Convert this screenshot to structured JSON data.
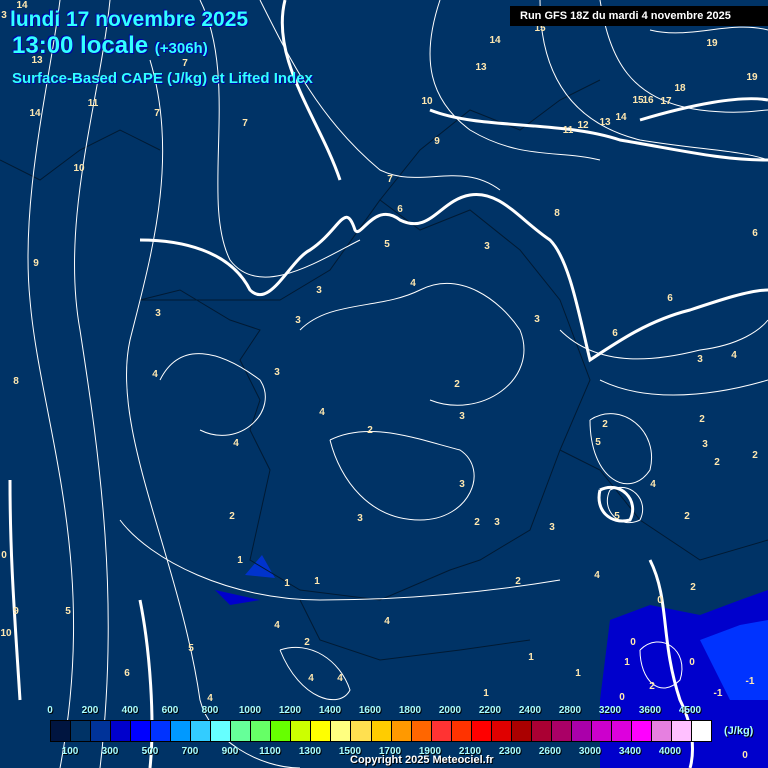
{
  "header": {
    "date": "lundi 17 novembre 2025",
    "time": "13:00 locale",
    "lead": "(+306h)",
    "parameter": "Surface-Based CAPE (J/kg) et Lifted Index",
    "run": "Run GFS 18Z du mardi 4 novembre 2025"
  },
  "colorbar": {
    "unit": "(J/kg)",
    "labels": [
      "0",
      "100",
      "200",
      "300",
      "400",
      "500",
      "600",
      "700",
      "800",
      "900",
      "1000",
      "1100",
      "1200",
      "1300",
      "1400",
      "1500",
      "1600",
      "1700",
      "1800",
      "1900",
      "2000",
      "2100",
      "2200",
      "2300",
      "2400",
      "2600",
      "2800",
      "3000",
      "3200",
      "3400",
      "3600",
      "4000",
      "4500"
    ],
    "colors": [
      "#001540",
      "#003366",
      "#003399",
      "#0000cc",
      "#0000ff",
      "#0033ff",
      "#0099ff",
      "#33ccff",
      "#66ffff",
      "#66ff99",
      "#66ff66",
      "#66ff00",
      "#ccff00",
      "#ffff00",
      "#ffff80",
      "#ffe050",
      "#ffcc00",
      "#ff9900",
      "#ff6600",
      "#ff3333",
      "#ff3300",
      "#ff0000",
      "#e00000",
      "#aa0000",
      "#aa0033",
      "#aa0066",
      "#aa00aa",
      "#cc00cc",
      "#dd00dd",
      "#ff00ff",
      "#e680e0",
      "#ffc0ff",
      "#ffffff"
    ]
  },
  "lifted_index_labels": [
    "14",
    "3",
    "13",
    "11",
    "14",
    "7",
    "7",
    "7",
    "10",
    "9",
    "8",
    "3",
    "4",
    "3",
    "3",
    "3",
    "4",
    "4",
    "2",
    "2",
    "1",
    "3",
    "5",
    "4",
    "6",
    "7",
    "9",
    "10",
    "13",
    "14",
    "15",
    "19",
    "19",
    "18",
    "15",
    "16",
    "17",
    "14",
    "13",
    "12",
    "11",
    "8",
    "3",
    "3",
    "2",
    "3",
    "3",
    "2",
    "3",
    "3",
    "2",
    "6",
    "6",
    "3",
    "4",
    "6",
    "2",
    "3",
    "5",
    "2",
    "2",
    "2",
    "4",
    "5",
    "2",
    "4",
    "0",
    "2",
    "0",
    "1",
    "0",
    "2",
    "1",
    "1",
    "1",
    "0",
    "-1",
    "-1",
    "0",
    "4",
    "4",
    "2",
    "5",
    "6",
    "5",
    "9",
    "10",
    "0",
    "1",
    "1",
    "4",
    "4",
    "4"
  ],
  "copyright": "Copyright 2025 Meteociel.fr"
}
